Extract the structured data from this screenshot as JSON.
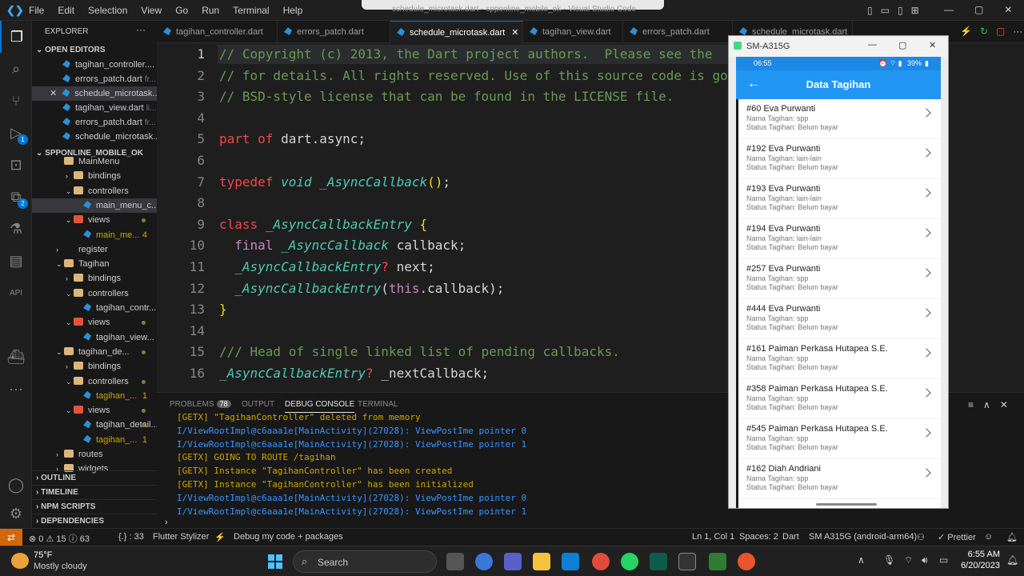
{
  "window": {
    "title": "schedule_microtask.dart - spponline_mobile_ok - Visual Studio Code"
  },
  "menu": [
    "File",
    "Edit",
    "Selection",
    "View",
    "Go",
    "Run",
    "Terminal",
    "Help"
  ],
  "activity": {
    "source_badge": "",
    "debug_badge": "1",
    "ext_badge": "2"
  },
  "sidebar": {
    "title": "EXPLORER",
    "open_editors_label": "OPEN EDITORS",
    "open_editors": [
      {
        "name": "tagihan_controller....",
        "hint": ""
      },
      {
        "name": "errors_patch.dart",
        "hint": "fr..."
      },
      {
        "name": "schedule_microtask...",
        "hint": ""
      },
      {
        "name": "tagihan_view.dart",
        "hint": "li..."
      },
      {
        "name": "errors_patch.dart",
        "hint": "fr..."
      },
      {
        "name": "schedule_microtask...",
        "hint": ""
      }
    ],
    "project_label": "SPPONLINE_MOBILE_OK",
    "tree": [
      {
        "label": "MainMenu",
        "type": "folder",
        "indent": 1
      },
      {
        "label": "bindings",
        "type": "folder",
        "indent": 2,
        "twist": "›"
      },
      {
        "label": "controllers",
        "type": "folder",
        "indent": 2,
        "twist": "⌄"
      },
      {
        "label": "main_menu_c...",
        "type": "dart",
        "indent": 3
      },
      {
        "label": "views",
        "type": "folder-red",
        "indent": 2,
        "twist": "⌄"
      },
      {
        "label": "main_me...",
        "type": "dart",
        "indent": 3,
        "count": "4"
      },
      {
        "label": "register",
        "type": "plain",
        "indent": 1,
        "twist": "›"
      },
      {
        "label": "Tagihan",
        "type": "folder",
        "indent": 1,
        "twist": "⌄"
      },
      {
        "label": "bindings",
        "type": "folder",
        "indent": 2,
        "twist": "›"
      },
      {
        "label": "controllers",
        "type": "folder",
        "indent": 2,
        "twist": "⌄"
      },
      {
        "label": "tagihan_contr...",
        "type": "dart",
        "indent": 3
      },
      {
        "label": "views",
        "type": "folder-red",
        "indent": 2,
        "twist": "⌄"
      },
      {
        "label": "tagihan_view...",
        "type": "dart",
        "indent": 3
      },
      {
        "label": "tagihan_de...",
        "type": "folder",
        "indent": 1,
        "twist": "⌄"
      },
      {
        "label": "bindings",
        "type": "folder",
        "indent": 2,
        "twist": "›"
      },
      {
        "label": "controllers",
        "type": "folder",
        "indent": 2,
        "twist": "⌄"
      },
      {
        "label": "tagihan_...",
        "type": "dart",
        "indent": 3,
        "count": "1"
      },
      {
        "label": "views",
        "type": "folder-red",
        "indent": 2,
        "twist": "⌄"
      },
      {
        "label": "tagihan_detail...",
        "type": "dart",
        "indent": 3
      },
      {
        "label": "tagihan_...",
        "type": "dart",
        "indent": 3,
        "count": "1"
      },
      {
        "label": "routes",
        "type": "folder",
        "indent": 1,
        "twist": "›"
      },
      {
        "label": "widgets",
        "type": "folder",
        "indent": 1,
        "twist": "›"
      }
    ],
    "sections": [
      "OUTLINE",
      "TIMELINE",
      "NPM SCRIPTS",
      "DEPENDENCIES"
    ]
  },
  "tabs": [
    {
      "label": "tagihan_controller.dart",
      "active": false
    },
    {
      "label": "errors_patch.dart",
      "active": false
    },
    {
      "label": "schedule_microtask.dart",
      "active": true
    },
    {
      "label": "tagihan_view.dart",
      "active": false
    },
    {
      "label": "errors_patch.dart",
      "active": false
    },
    {
      "label": "schedule_microtask.dart",
      "active": false
    }
  ],
  "editor": {
    "line_numbers": [
      "1",
      "2",
      "3",
      "4",
      "5",
      "6",
      "7",
      "8",
      "9",
      "10",
      "11",
      "12",
      "13",
      "14",
      "15",
      "16"
    ],
    "lines": [
      "// Copyright (c) 2013, the Dart project authors.  Please see the",
      "// for details. All rights reserved. Use of this source code is go",
      "// BSD-style license that can be found in the LICENSE file.",
      "",
      "part of dart.async;",
      "",
      "typedef void _AsyncCallback();",
      "",
      "class _AsyncCallbackEntry {",
      "  final _AsyncCallback callback;",
      "  _AsyncCallbackEntry? next;",
      "  _AsyncCallbackEntry(this.callback);",
      "}",
      "",
      "/// Head of single linked list of pending callbacks.",
      "_AsyncCallbackEntry? _nextCallback;"
    ]
  },
  "panel": {
    "tabs": [
      "PROBLEMS",
      "OUTPUT",
      "DEBUG CONSOLE",
      "TERMINAL"
    ],
    "problems_count": "78",
    "logs": [
      {
        "text": "[GETX] \"TagihanController\" deleted from memory",
        "kind": "yel"
      },
      {
        "text": "I/ViewRootImpl@c6aaa1e[MainActivity](27028): ViewPostIme pointer 0",
        "kind": "blue"
      },
      {
        "text": "I/ViewRootImpl@c6aaa1e[MainActivity](27028): ViewPostIme pointer 1",
        "kind": "blue"
      },
      {
        "text": "[GETX] GOING TO ROUTE /tagihan",
        "kind": "yel"
      },
      {
        "text": "[GETX] Instance \"TagihanController\" has been created",
        "kind": "yel"
      },
      {
        "text": "[GETX] Instance \"TagihanController\" has been initialized",
        "kind": "yel"
      },
      {
        "text": "I/ViewRootImpl@c6aaa1e[MainActivity](27028): ViewPostIme pointer 0",
        "kind": "blue"
      },
      {
        "text": "I/ViewRootImpl@c6aaa1e[MainActivity](27028): ViewPostIme pointer 1",
        "kind": "blue"
      }
    ]
  },
  "status": {
    "errors": "⊗ 0 ⚠ 15 ⓘ 63",
    "braces": "{.} : 33",
    "stylizer": "Flutter Stylizer",
    "debug": "Debug my code + packages",
    "position": "Ln 1, Col 1",
    "spaces": "Spaces: 2",
    "lang": "Dart",
    "device": "SM A315G (android-arm64)",
    "prettier": "✓ Prettier"
  },
  "phone": {
    "window_title": "SM-A315G",
    "time": "06:55",
    "battery": "39%",
    "app_title": "Data Tagihan",
    "items": [
      {
        "title": "#60 Eva Purwanti",
        "nama": "Nama Tagihan: spp",
        "status": "Status Tagihan:  Belum bayar"
      },
      {
        "title": "#192 Eva Purwanti",
        "nama": "Nama Tagihan: lain-lain",
        "status": "Status Tagihan:  Belum bayar"
      },
      {
        "title": "#193 Eva Purwanti",
        "nama": "Nama Tagihan: lain-lain",
        "status": "Status Tagihan:  Belum bayar"
      },
      {
        "title": "#194 Eva Purwanti",
        "nama": "Nama Tagihan: lain-lain",
        "status": "Status Tagihan:  Belum bayar"
      },
      {
        "title": "#257 Eva Purwanti",
        "nama": "Nama Tagihan: spp",
        "status": "Status Tagihan:  Belum bayar"
      },
      {
        "title": "#444 Eva Purwanti",
        "nama": "Nama Tagihan: spp",
        "status": "Status Tagihan:  Belum bayar"
      },
      {
        "title": "#161 Paiman Perkasa Hutapea S.E.",
        "nama": "Nama Tagihan: spp",
        "status": "Status Tagihan:  Belum bayar"
      },
      {
        "title": "#358 Paiman Perkasa Hutapea S.E.",
        "nama": "Nama Tagihan: spp",
        "status": "Status Tagihan:  Belum bayar"
      },
      {
        "title": "#545 Paiman Perkasa Hutapea S.E.",
        "nama": "Nama Tagihan: spp",
        "status": "Status Tagihan:  Belum bayar"
      },
      {
        "title": "#162 Diah Andriani",
        "nama": "Nama Tagihan: spp",
        "status": "Status Tagihan:  Belum bayar"
      }
    ]
  },
  "taskbar": {
    "weather_temp": "75°F",
    "weather_desc": "Mostly cloudy",
    "search": "Search",
    "time": "6:55 AM",
    "date": "6/20/2023"
  },
  "colors": {
    "accent": "#0078d4",
    "app_bar": "#2196f3",
    "remote": "#d1670a"
  }
}
